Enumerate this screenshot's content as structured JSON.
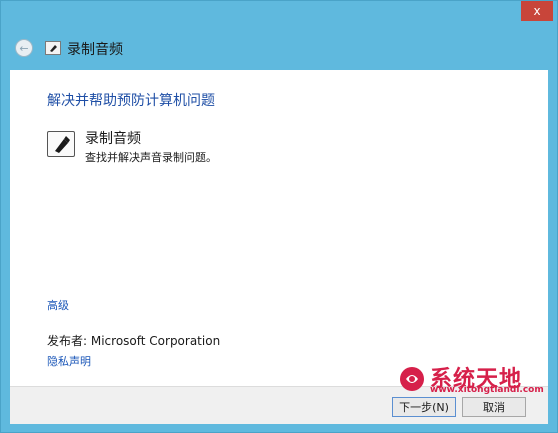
{
  "window": {
    "title": "录制音频",
    "close_glyph": "x",
    "back_glyph": "←"
  },
  "main": {
    "heading": "解决并帮助预防计算机问题",
    "item": {
      "icon": "microphone-icon",
      "title": "录制音频",
      "description": "查找并解决声音录制问题。"
    },
    "advanced_link": "高级",
    "publisher_label": "发布者: ",
    "publisher_value": "Microsoft Corporation",
    "privacy_link": "隐私声明"
  },
  "footer": {
    "next_label": "下一步(N)",
    "cancel_label": "取消"
  },
  "watermark": {
    "text": "系统天地",
    "url": "www.xitongtiandi.com"
  },
  "colors": {
    "window_frame": "#5fb9de",
    "link": "#1a56b8",
    "heading": "#1f4fa6",
    "close_button": "#c8453a",
    "watermark": "#d6204a"
  }
}
